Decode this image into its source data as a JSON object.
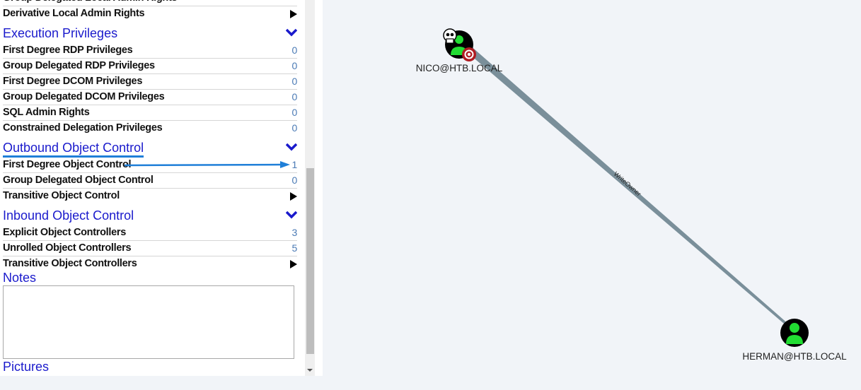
{
  "panel": {
    "rows_top": [
      {
        "label": "Group Delegated Local Admin Rights",
        "type": "partial"
      },
      {
        "label": "Derivative Local Admin Rights",
        "type": "arrow"
      }
    ],
    "sections": [
      {
        "title": "Execution Privileges",
        "rows": [
          {
            "label": "First Degree RDP Privileges",
            "value": "0"
          },
          {
            "label": "Group Delegated RDP Privileges",
            "value": "0"
          },
          {
            "label": "First Degree DCOM Privileges",
            "value": "0"
          },
          {
            "label": "Group Delegated DCOM Privileges",
            "value": "0"
          },
          {
            "label": "SQL Admin Rights",
            "value": "0"
          },
          {
            "label": "Constrained Delegation Privileges",
            "value": "0"
          }
        ]
      },
      {
        "title": "Outbound Object Control",
        "rows": [
          {
            "label": "First Degree Object Control",
            "value": "1"
          },
          {
            "label": "Group Delegated Object Control",
            "value": "0"
          },
          {
            "label": "Transitive Object Control",
            "value": null
          }
        ]
      },
      {
        "title": "Inbound Object Control",
        "rows": [
          {
            "label": "Explicit Object Controllers",
            "value": "3"
          },
          {
            "label": "Unrolled Object Controllers",
            "value": "5"
          },
          {
            "label": "Transitive Object Controllers",
            "value": null
          }
        ]
      }
    ],
    "notes_title": "Notes",
    "notes_value": "",
    "pictures_title": "Pictures"
  },
  "graph": {
    "nodes": [
      {
        "id": "nico",
        "label": "NICO@HTB.LOCAL",
        "badges": [
          "owned-skull",
          "target"
        ]
      },
      {
        "id": "herman",
        "label": "HERMAN@HTB.LOCAL",
        "badges": []
      }
    ],
    "edges": [
      {
        "from": "nico",
        "to": "herman",
        "label": "WriteOwner"
      }
    ]
  },
  "colors": {
    "section_title": "#1a1acc",
    "count_value": "#4a7ab5",
    "annotation": "#1f7fd8",
    "user_icon": "#22dd33",
    "edge": "#7a8f9a",
    "graph_bg": "#f1f4f8"
  }
}
